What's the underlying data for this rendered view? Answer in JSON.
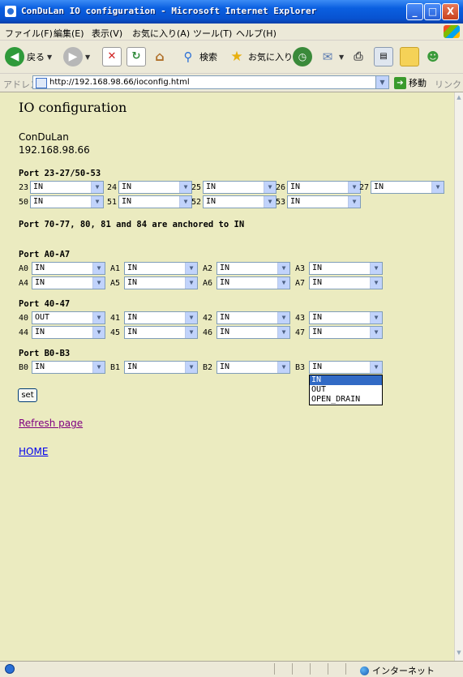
{
  "window": {
    "title": "ConDuLan IO configuration - Microsoft Internet Explorer",
    "min": "_",
    "max": "□",
    "close": "X"
  },
  "menu": [
    "ファイル(F)",
    "編集(E)",
    "表示(V)",
    "お気に入り(A)",
    "ツール(T)",
    "ヘルプ(H)"
  ],
  "toolbar": {
    "back": "戻る",
    "search": "検索",
    "favorites": "お気に入り"
  },
  "address": {
    "label": "アドレス(D)",
    "url": "http://192.168.98.66/ioconfig.html",
    "go": "移動",
    "links": "リンク"
  },
  "page": {
    "title": "IO configuration",
    "device_name": "ConDuLan",
    "device_ip": "192.168.98.66",
    "port_groups": [
      {
        "heading": "Port 23-27/50-53",
        "rows": [
          [
            {
              "label": "23",
              "value": "IN"
            },
            {
              "label": "24",
              "value": "IN"
            },
            {
              "label": "25",
              "value": "IN"
            },
            {
              "label": "26",
              "value": "IN"
            },
            {
              "label": "27",
              "value": "IN"
            }
          ],
          [
            {
              "label": "50",
              "value": "IN"
            },
            {
              "label": "51",
              "value": "IN"
            },
            {
              "label": "52",
              "value": "IN"
            },
            {
              "label": "53",
              "value": "IN"
            }
          ]
        ]
      },
      {
        "heading": "Port A0-A7",
        "rows": [
          [
            {
              "label": "A0",
              "value": "IN"
            },
            {
              "label": "A1",
              "value": "IN"
            },
            {
              "label": "A2",
              "value": "IN"
            },
            {
              "label": "A3",
              "value": "IN"
            }
          ],
          [
            {
              "label": "A4",
              "value": "IN"
            },
            {
              "label": "A5",
              "value": "IN"
            },
            {
              "label": "A6",
              "value": "IN"
            },
            {
              "label": "A7",
              "value": "IN"
            }
          ]
        ]
      },
      {
        "heading": "Port 40-47",
        "rows": [
          [
            {
              "label": "40",
              "value": "OUT"
            },
            {
              "label": "41",
              "value": "IN"
            },
            {
              "label": "42",
              "value": "IN"
            },
            {
              "label": "43",
              "value": "IN"
            }
          ],
          [
            {
              "label": "44",
              "value": "IN"
            },
            {
              "label": "45",
              "value": "IN"
            },
            {
              "label": "46",
              "value": "IN"
            },
            {
              "label": "47",
              "value": "IN"
            }
          ]
        ]
      },
      {
        "heading": "Port B0-B3",
        "rows": [
          [
            {
              "label": "B0",
              "value": "IN"
            },
            {
              "label": "B1",
              "value": "IN"
            },
            {
              "label": "B2",
              "value": "IN"
            },
            {
              "label": "B3",
              "value": "IN"
            }
          ]
        ]
      }
    ],
    "note": "Port 70-77, 80, 81 and 84 are anchored to IN",
    "dropdown_options": [
      "IN",
      "OUT",
      "OPEN_DRAIN"
    ],
    "dropdown_selected": "IN",
    "set_label": "set",
    "refresh_link": "Refresh page",
    "home_link": "HOME"
  },
  "status": {
    "zone": "インターネット"
  }
}
